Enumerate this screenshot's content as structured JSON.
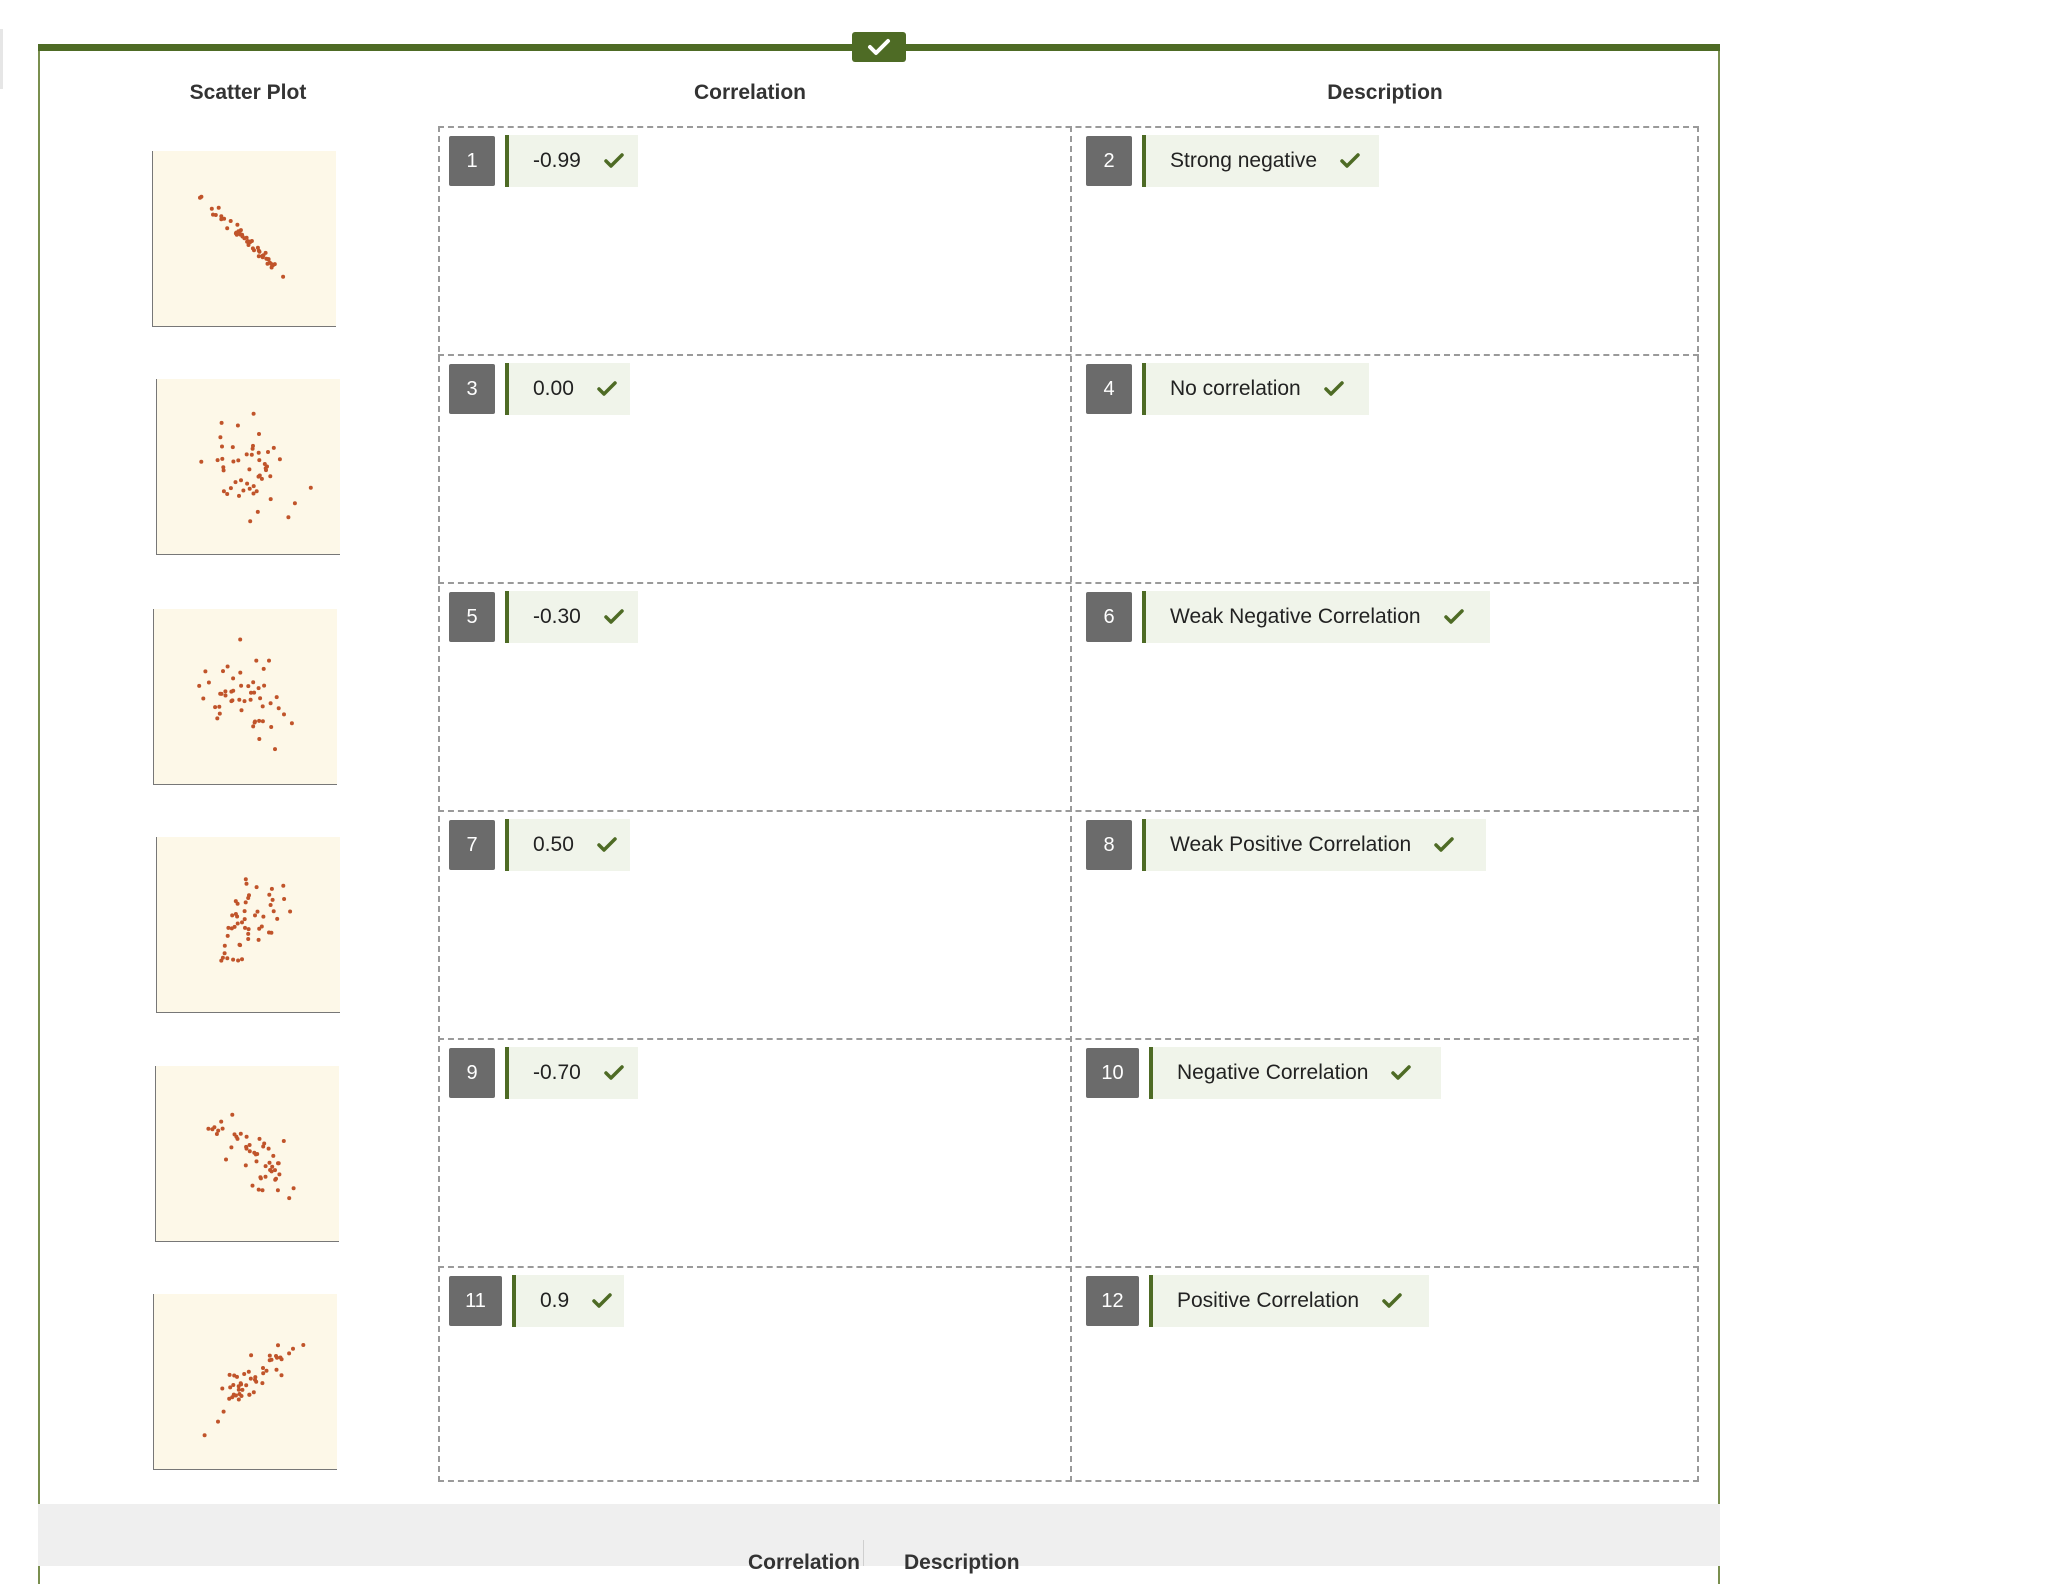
{
  "headers": {
    "scatter_plot": "Scatter Plot",
    "correlation": "Correlation",
    "description": "Description"
  },
  "rows": [
    {
      "corr_index": "1",
      "correlation": "-0.99",
      "desc_index": "2",
      "description": "Strong negative"
    },
    {
      "corr_index": "3",
      "correlation": "0.00",
      "desc_index": "4",
      "description": "No correlation"
    },
    {
      "corr_index": "5",
      "correlation": "-0.30",
      "desc_index": "6",
      "description": "Weak Negative Correlation"
    },
    {
      "corr_index": "7",
      "correlation": "0.50",
      "desc_index": "8",
      "description": "Weak Positive Correlation"
    },
    {
      "corr_index": "9",
      "correlation": "-0.70",
      "desc_index": "10",
      "description": "Negative Correlation"
    },
    {
      "corr_index": "11",
      "correlation": "0.9",
      "desc_index": "12",
      "description": "Positive Correlation"
    }
  ],
  "footer": {
    "correlation": "Correlation",
    "description": "Description"
  },
  "icons": {
    "status": "check-icon",
    "answer_correct": "check-icon"
  },
  "colors": {
    "accent": "#4e6b25",
    "plot_background": "#fdf8e8",
    "dot": "#c0542a",
    "index_box": "#6b6b6b",
    "chip_background": "#f0f4ea"
  }
}
